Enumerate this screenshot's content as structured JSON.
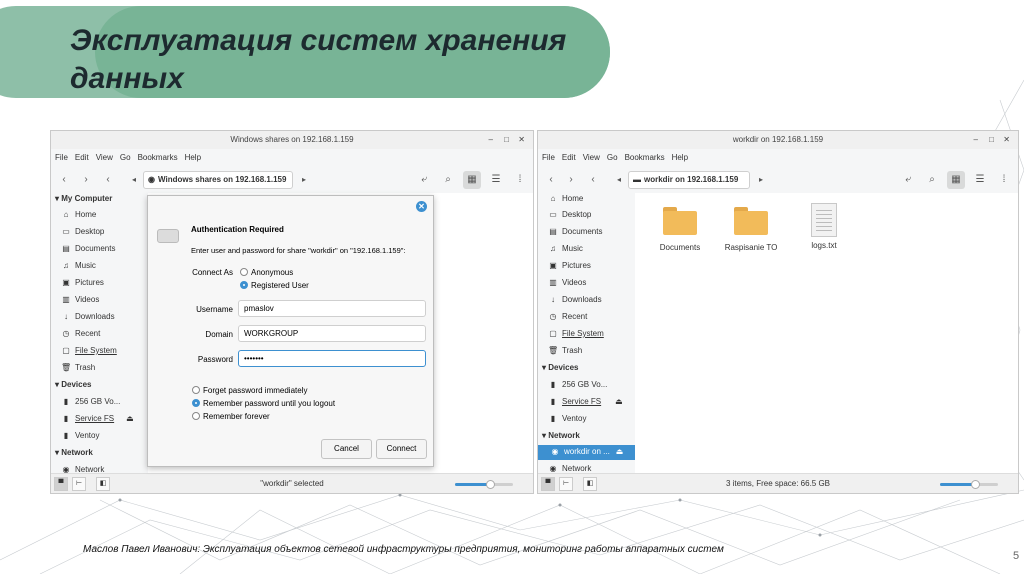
{
  "slide": {
    "title": "Эксплуатация систем хранения данных",
    "footer": "Маслов Павел Иванович: Эксплуатация объектов сетевой инфраструктуры предприятия, мониторинг работы аппаратных систем",
    "page_number": "5"
  },
  "colors": {
    "title_pill": "#78b496",
    "accent": "#3d90d0",
    "folder": "#f2bb5a"
  },
  "left_window": {
    "title": "Windows shares on 192.168.1.159",
    "controls": [
      "–",
      "□",
      "✕"
    ],
    "menu": [
      "File",
      "Edit",
      "View",
      "Go",
      "Bookmarks",
      "Help"
    ],
    "location": "Windows shares on 192.168.1.159",
    "sidebar": {
      "my_computer_header": "My Computer",
      "my_computer": [
        "Home",
        "Desktop",
        "Documents",
        "Music",
        "Pictures",
        "Videos",
        "Downloads",
        "Recent",
        "File System",
        "Trash"
      ],
      "devices_header": "Devices",
      "devices": [
        "256 GB Vo...",
        "Service FS",
        "Ventoy"
      ],
      "network_header": "Network",
      "network": [
        "Network"
      ]
    },
    "status": "\"workdir\" selected",
    "zoom_level": 0.6
  },
  "dialog": {
    "title": "Authentication Required",
    "message": "Enter user and password for share \"workdir\" on \"192.168.1.159\":",
    "connect_as_label": "Connect As",
    "option_anonymous": "Anonymous",
    "option_registered": "Registered User",
    "username_label": "Username",
    "username_value": "pmaslov",
    "domain_label": "Domain",
    "domain_value": "WORKGROUP",
    "password_label": "Password",
    "password_value": "•••••••",
    "forget_immediately": "Forget password immediately",
    "remember_until_logout": "Remember password until you logout",
    "remember_forever": "Remember forever",
    "cancel_label": "Cancel",
    "connect_label": "Connect"
  },
  "right_window": {
    "title": "workdir on 192.168.1.159",
    "controls": [
      "–",
      "□",
      "✕"
    ],
    "menu": [
      "File",
      "Edit",
      "View",
      "Go",
      "Bookmarks",
      "Help"
    ],
    "location": "workdir on 192.168.1.159",
    "sidebar": {
      "my_computer": [
        "Home",
        "Desktop",
        "Documents",
        "Music",
        "Pictures",
        "Videos",
        "Downloads",
        "Recent",
        "File System",
        "Trash"
      ],
      "devices_header": "Devices",
      "devices": [
        "256 GB Vo...",
        "Service FS",
        "Ventoy"
      ],
      "network_header": "Network",
      "network": [
        "workdir on ...",
        "Network"
      ]
    },
    "files": [
      "Documents",
      "Raspisanie TO",
      "logs.txt"
    ],
    "status": "3 items, Free space: 66.5 GB",
    "zoom_level": 0.6
  }
}
